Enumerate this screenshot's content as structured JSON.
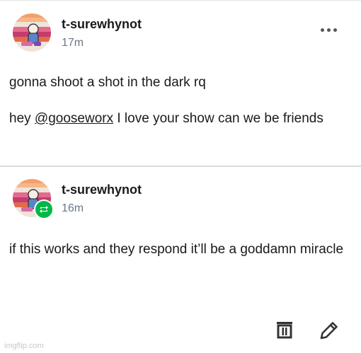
{
  "posts": [
    {
      "username": "t-surewhynot",
      "time": "17m",
      "paragraphs": {
        "first": "gonna shoot a shot in the dark rq",
        "mention_prefix": "hey ",
        "mention": "@gooseworx",
        "mention_suffix": " I love your show can we be friends"
      },
      "more_icon": "ellipsis-icon"
    },
    {
      "username": "t-surewhynot",
      "time": "16m",
      "text": "if this works and they respond it’ll be a goddamn miracle",
      "badge_icon": "reblog-icon",
      "actions": [
        "trash-icon",
        "pencil-icon"
      ]
    }
  ],
  "watermark": "imgflip.com",
  "colors": {
    "reblog_green": "#00b84a",
    "muted_text": "#6b7785"
  }
}
